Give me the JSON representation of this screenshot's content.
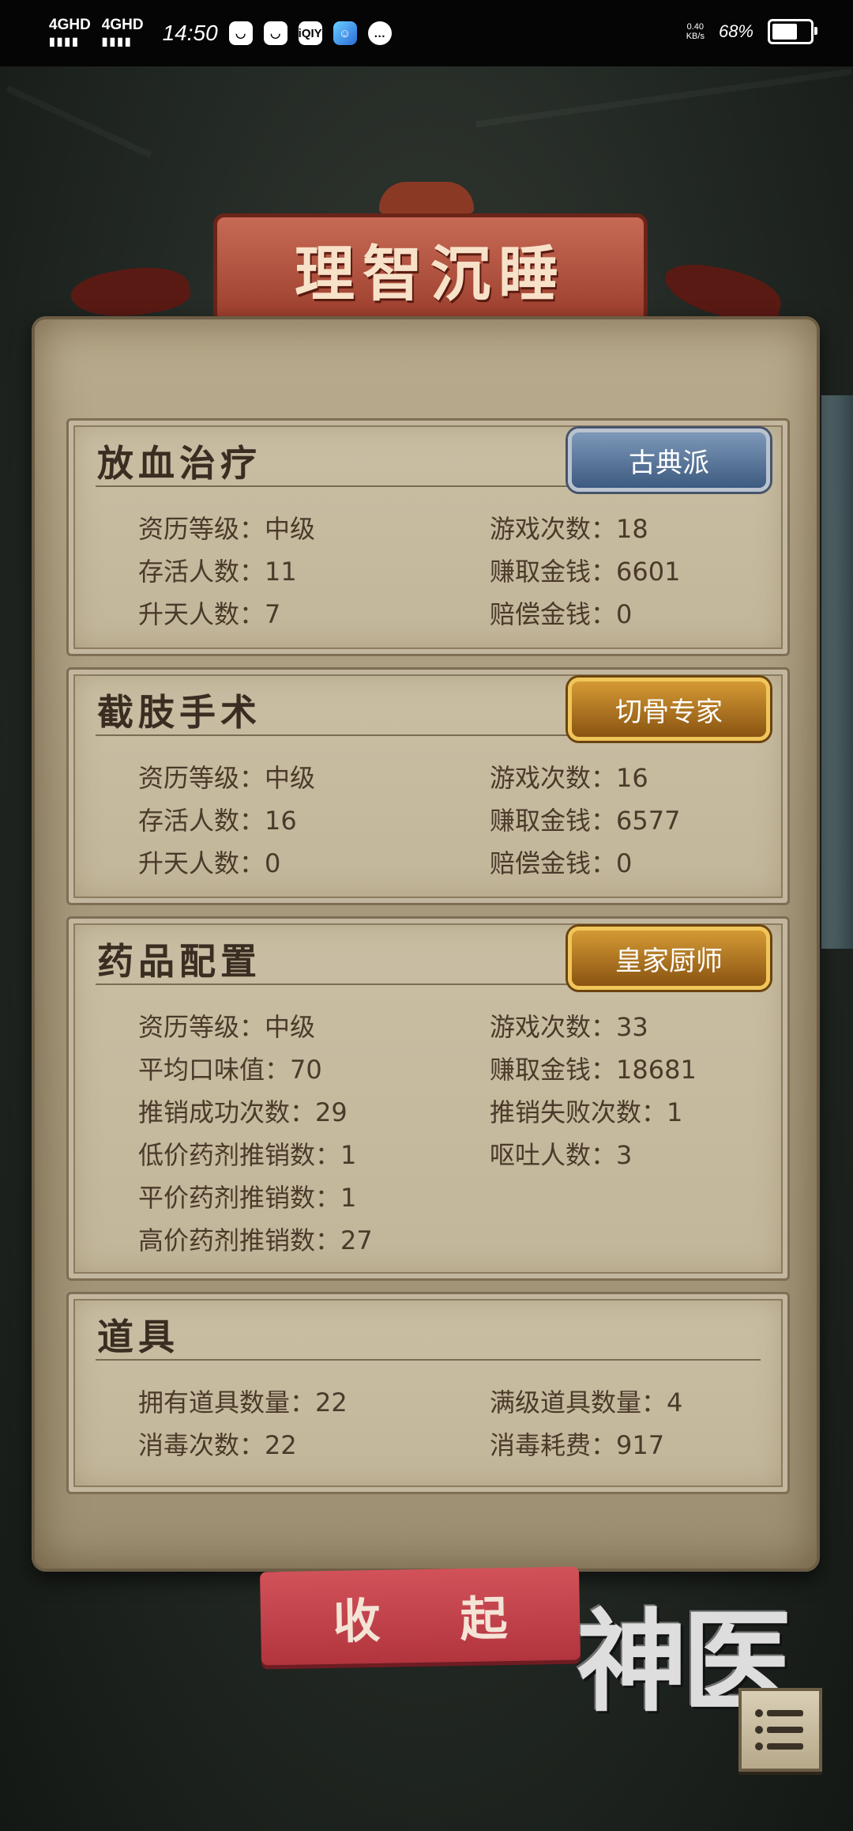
{
  "status_bar": {
    "signal1": "4GHD",
    "signal2": "4GHD",
    "time": "14:50",
    "apps": [
      "",
      "",
      "iQIY",
      "",
      ""
    ],
    "net_speed_value": "0.40",
    "net_speed_unit": "KB/s",
    "battery_pct": "68%",
    "battery_level": 0.68
  },
  "title": "理智沉睡",
  "sections": [
    {
      "heading": "放血治疗",
      "badge": "古典派",
      "badge_color": "blue",
      "stats": [
        "资历等级：中级",
        "游戏次数：18",
        "存活人数：11",
        "赚取金钱：6601",
        "升天人数：7",
        "赔偿金钱：0"
      ]
    },
    {
      "heading": "截肢手术",
      "badge": "切骨专家",
      "badge_color": "gold",
      "stats": [
        "资历等级：中级",
        "游戏次数：16",
        "存活人数：16",
        "赚取金钱：6577",
        "升天人数：0",
        "赔偿金钱：0"
      ]
    },
    {
      "heading": "药品配置",
      "badge": "皇家厨师",
      "badge_color": "gold",
      "stats": [
        "资历等级：中级",
        "游戏次数：33",
        "平均口味值：70",
        "赚取金钱：18681",
        "推销成功次数：29",
        "推销失败次数：1",
        "低价药剂推销数：1",
        "呕吐人数：3",
        "平价药剂推销数：1",
        "",
        "高价药剂推销数：27",
        ""
      ]
    },
    {
      "heading": "道具",
      "badge": "",
      "badge_color": "",
      "stats": [
        "拥有道具数量：22",
        "满级道具数量：4",
        "消毒次数：22",
        "消毒耗费：917"
      ]
    }
  ],
  "collapse_button": "收 起",
  "logo_text": "神医",
  "colors": {
    "parchment": "#b9ab8d",
    "banner": "#b44a3a",
    "button": "#c2404a",
    "text": "#4a3a2a"
  }
}
